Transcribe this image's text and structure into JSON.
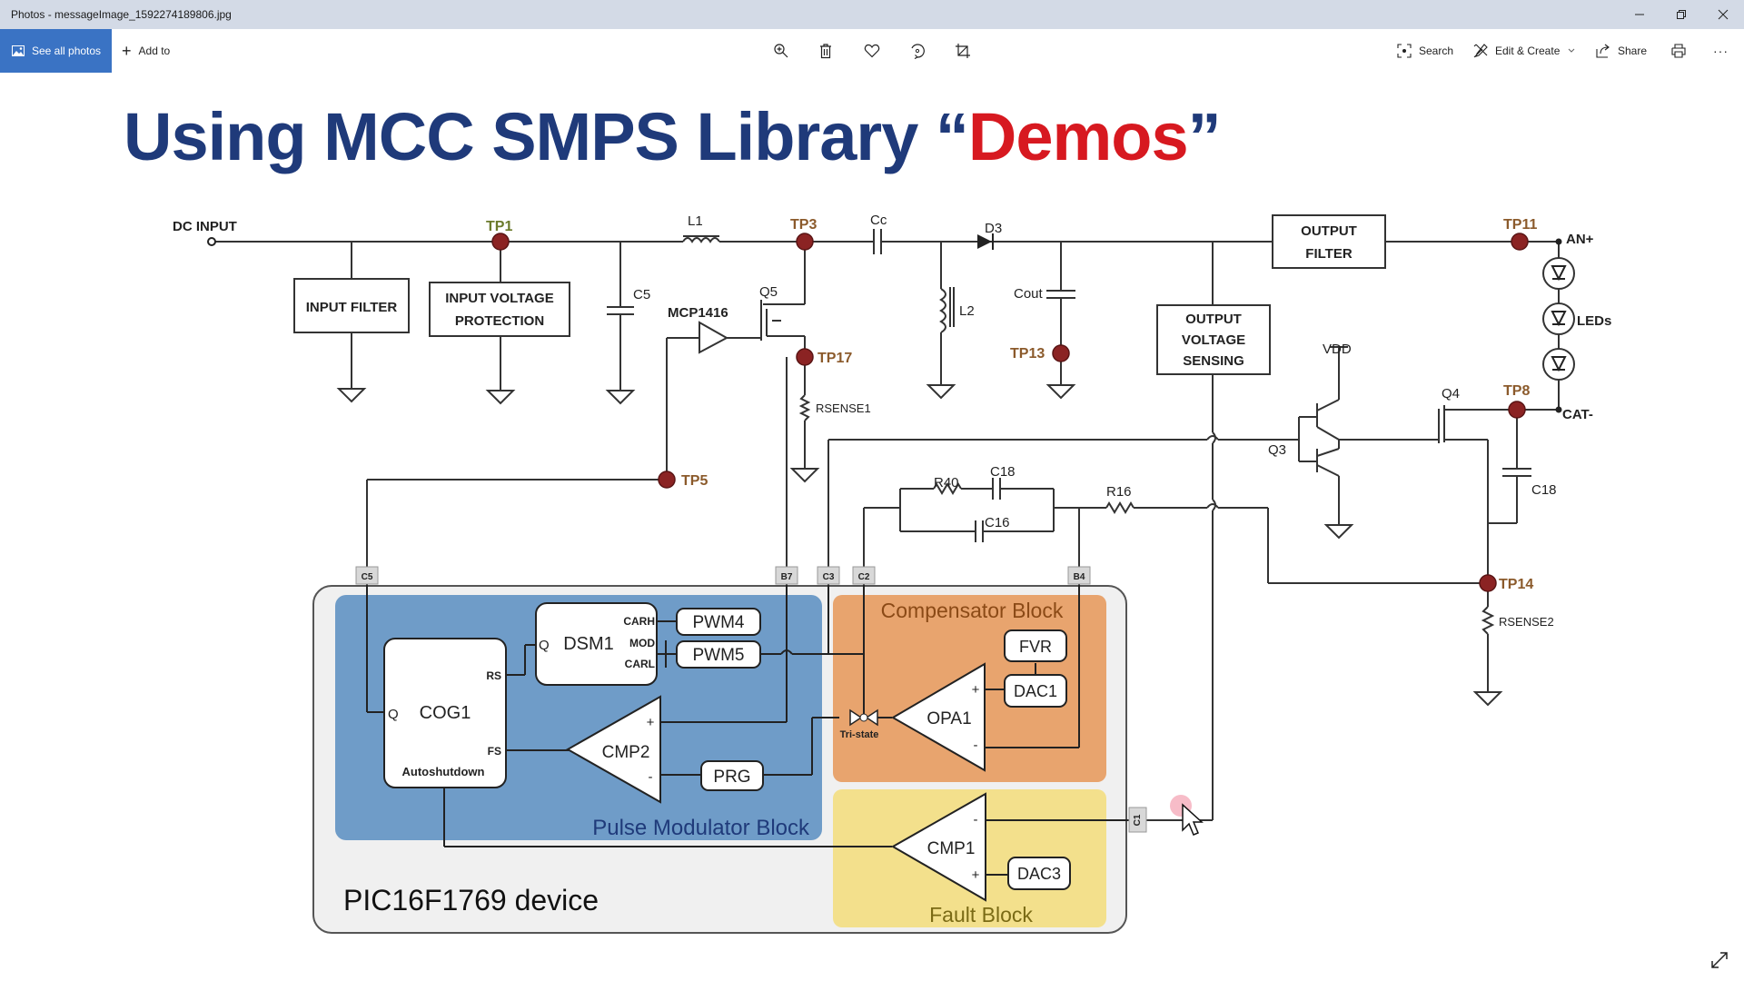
{
  "window": {
    "title": "Photos - messageImage_1592274189806.jpg",
    "controls": [
      "minimize",
      "restore",
      "close"
    ]
  },
  "toolbar": {
    "see_all_photos": "See all photos",
    "add_to": "Add to",
    "center_icons": [
      "zoom-in-icon",
      "delete-icon",
      "favorite-icon",
      "rotate-icon",
      "crop-icon"
    ],
    "search": "Search",
    "edit_create": "Edit & Create",
    "share": "Share",
    "print": "print-icon",
    "more": "···"
  },
  "slide": {
    "title_main": "Using MCC SMPS Library ",
    "title_quote_open": "“",
    "title_highlight": "Demos",
    "title_quote_close": "”",
    "colors": {
      "title_blue": "#1f3a7a",
      "title_red": "#d71920",
      "testpoint": "#8b2323",
      "tp_label": "#8b5a2b",
      "pulse_block": "#6f9cc8",
      "comp_block": "#e8a46e",
      "fault_block": "#f3e08c"
    }
  },
  "schematic": {
    "labels": {
      "dc_input": "DC INPUT",
      "input_filter": "INPUT FILTER",
      "ivp_line1": "INPUT VOLTAGE",
      "ivp_line2": "PROTECTION",
      "c5": "C5",
      "l1": "L1",
      "mcp": "MCP1416",
      "q5": "Q5",
      "cc": "Cc",
      "d3": "D3",
      "l2": "L2",
      "cout": "Cout",
      "rsense1": "RSENSE1",
      "of_line1": "OUTPUT",
      "of_line2": "FILTER",
      "ovs_line1": "OUTPUT",
      "ovs_line2": "VOLTAGE",
      "ovs_line3": "SENSING",
      "an": "AN+",
      "leds": "LEDs",
      "cat": "CAT-",
      "vdd": "VDD",
      "q3": "Q3",
      "q4": "Q4",
      "r40": "R40",
      "c18a": "C18",
      "c16": "C16",
      "r16": "R16",
      "c18b": "C18",
      "rsense2": "RSENSE2"
    },
    "testpoints": {
      "tp1": "TP1",
      "tp3": "TP3",
      "tp17": "TP17",
      "tp13": "TP13",
      "tp11": "TP11",
      "tp8": "TP8",
      "tp5": "TP5",
      "tp14": "TP14"
    },
    "pins": {
      "c5": "C5",
      "b7": "B7",
      "c3": "C3",
      "c2": "C2",
      "b4": "B4",
      "c1": "C1"
    },
    "device": {
      "name": "PIC16F1769 device",
      "pulse_block": "Pulse Modulator Block",
      "comp_block": "Compensator Block",
      "fault_block": "Fault Block",
      "cog1": "COG1",
      "cog_q": "Q",
      "cog_rs": "RS",
      "cog_fs": "FS",
      "autoshutdown": "Autoshutdown",
      "dsm1": "DSM1",
      "dsm_q": "Q",
      "carh": "CARH",
      "mod": "MOD",
      "carl": "CARL",
      "pwm4": "PWM4",
      "pwm5": "PWM5",
      "cmp2": "CMP2",
      "prg": "PRG",
      "opa1": "OPA1",
      "tristate": "Tri-state",
      "fvr": "FVR",
      "dac1": "DAC1",
      "cmp1": "CMP1",
      "dac3": "DAC3",
      "plus": "+",
      "minus": "-"
    }
  }
}
